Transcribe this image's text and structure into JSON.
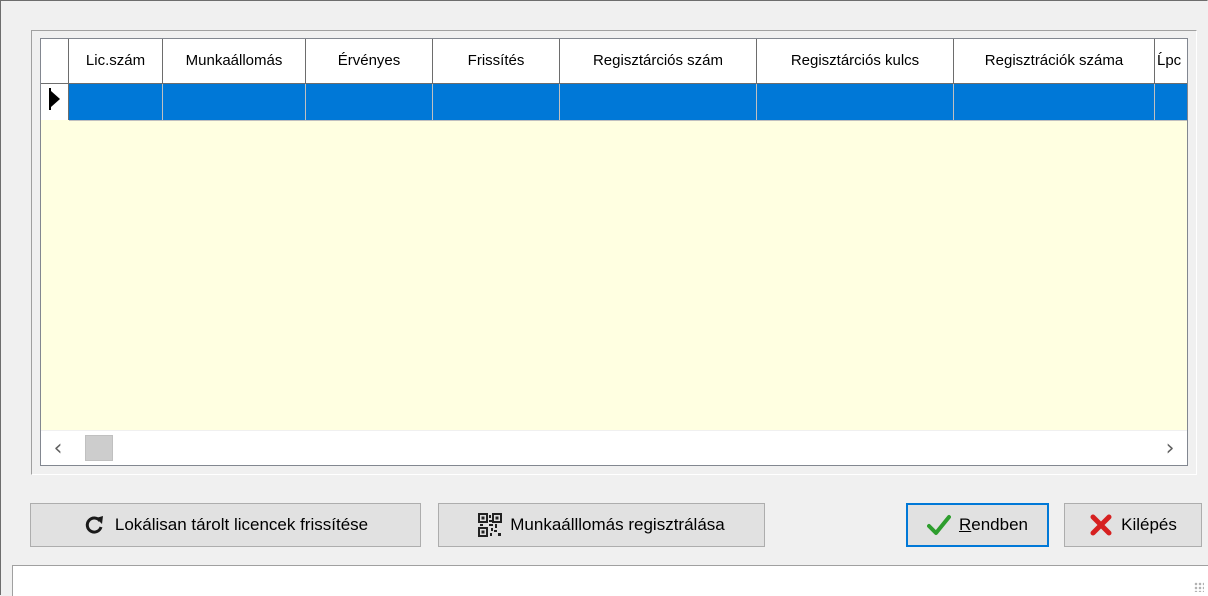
{
  "grid": {
    "columns": [
      "Lic.szám",
      "Munkaállomás",
      "Érvényes",
      "Frissítés",
      "Regisztárciós szám",
      "Regisztárciós kulcs",
      "Regisztrációk száma",
      "Ĺpc"
    ],
    "selected_row": 1
  },
  "buttons": {
    "refresh_label": "Lokálisan tárolt licencek frissítése",
    "register_label": "Munkaálllomás regisztrálása",
    "ok_label": "Rendben",
    "exit_label": "Kilépés"
  },
  "icons": {
    "refresh": "refresh-icon",
    "register": "qr-code-icon",
    "ok": "checkmark-icon",
    "exit": "red-x-icon",
    "scroll_left": "chevron-left-icon",
    "scroll_right": "chevron-right-icon"
  },
  "colors": {
    "selection": "#0078d7",
    "grid_background": "#ffffe1",
    "ok_check": "#2e9e2e",
    "exit_x": "#d62020"
  }
}
